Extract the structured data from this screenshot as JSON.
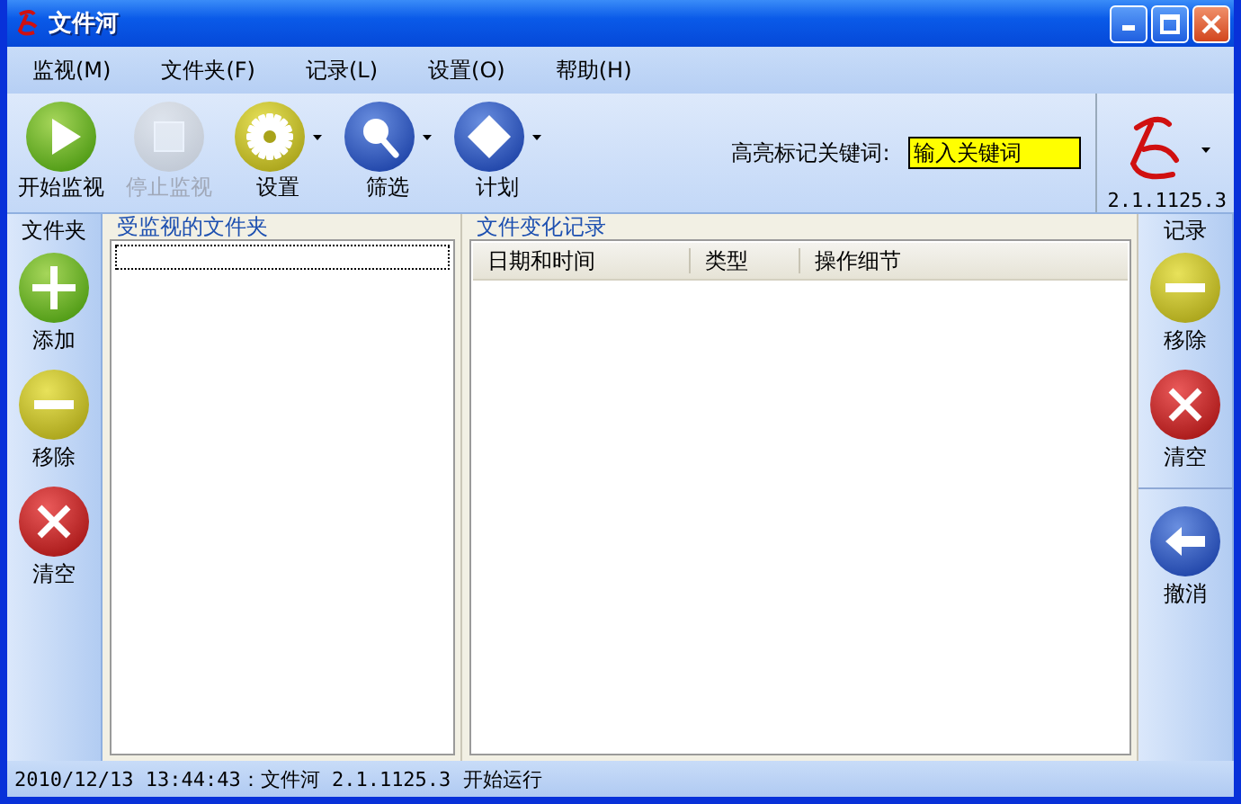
{
  "window": {
    "title": "文件河"
  },
  "menu": [
    "监视(M)",
    "文件夹(F)",
    "记录(L)",
    "设置(O)",
    "帮助(H)"
  ],
  "toolbar": {
    "buttons": [
      {
        "label": "开始监视",
        "kind": "play",
        "disabled": false,
        "dropdown": false
      },
      {
        "label": "停止监视",
        "kind": "stop",
        "disabled": true,
        "dropdown": false
      },
      {
        "label": "设置",
        "kind": "gear",
        "disabled": false,
        "dropdown": true
      },
      {
        "label": "筛选",
        "kind": "search",
        "disabled": false,
        "dropdown": true
      },
      {
        "label": "计划",
        "kind": "diamond",
        "disabled": false,
        "dropdown": true
      }
    ],
    "keyword_label": "高亮标记关键词:",
    "keyword_field": {
      "placeholder": "输入关键词"
    },
    "version": "2.1.1125.3"
  },
  "left_sidebar": {
    "title": "文件夹",
    "groups": [
      [
        {
          "label": "添加",
          "kind": "add"
        },
        {
          "label": "移除",
          "kind": "remove"
        },
        {
          "label": "清空",
          "kind": "clear"
        }
      ]
    ]
  },
  "folder_panel": {
    "title": "受监视的文件夹"
  },
  "log_panel": {
    "title": "文件变化记录",
    "columns": [
      "日期和时间",
      "类型",
      "操作细节"
    ]
  },
  "right_sidebar": {
    "title": "记录",
    "groups": [
      [
        {
          "label": "移除",
          "kind": "remove"
        },
        {
          "label": "清空",
          "kind": "clear"
        }
      ],
      [
        {
          "label": "撤消",
          "kind": "undo"
        }
      ]
    ]
  },
  "status_bar": "2010/12/13 13:44:43：文件河 2.1.1125.3 开始运行"
}
